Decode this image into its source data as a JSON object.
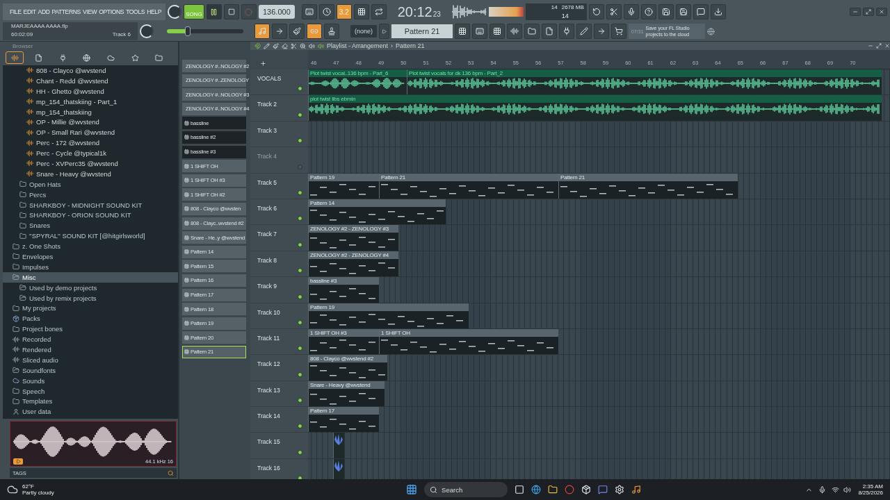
{
  "menu": [
    "FILE",
    "EDIT",
    "ADD",
    "PATTERNS",
    "VIEW",
    "OPTIONS",
    "TOOLS",
    "HELP"
  ],
  "project": {
    "file": "MARJEAAAA AAAA.flp",
    "time": "60:02:09",
    "track": "Track 6"
  },
  "transport": {
    "mode": "SONG",
    "playing": true,
    "recording": false,
    "tempo": "136.000",
    "time": "20:12",
    "ticks": "23"
  },
  "master_volume": {
    "level": 0.27
  },
  "toggles": [
    {
      "kind": "typing",
      "on": false
    },
    {
      "kind": "wait",
      "on": false
    },
    {
      "kind": "countdown",
      "label": "3.2",
      "on": true
    },
    {
      "kind": "step",
      "on": false
    },
    {
      "kind": "loop",
      "on": false
    }
  ],
  "memory": {
    "cpu": "14",
    "ram": "2678 MB",
    "polyphony": "14"
  },
  "edit_tools": [
    {
      "kind": "grid",
      "on": true
    },
    {
      "kind": "arrow",
      "on": false
    },
    {
      "kind": "brush",
      "on": false
    },
    {
      "kind": "link",
      "on": true
    },
    {
      "kind": "stamp",
      "on": false
    }
  ],
  "snap": "(none)",
  "pattern": "Pattern 21",
  "hint": {
    "counter": "07/31",
    "text": "Save your FL Studio projects to the cloud"
  },
  "browser": {
    "title": "Browser",
    "tree": [
      {
        "children": [
          {
            "children": [
              {
                "label": "808 - Clayco @wvstend",
                "kind": "file",
                "selected": false
              },
              {
                "label": "Chant - Redd @wvstend",
                "kind": "file",
                "selected": false
              },
              {
                "label": "HH - Ghetto @wvstend",
                "kind": "file",
                "selected": false
              },
              {
                "label": "mp_154_thatskiing - Part_1",
                "kind": "file",
                "selected": false
              },
              {
                "label": "mp_154_thatskiing",
                "kind": "file",
                "selected": false
              },
              {
                "label": "OP - Millie @wvstend",
                "kind": "file",
                "selected": false
              },
              {
                "label": "OP - Small Rari @wvstend",
                "kind": "file",
                "selected": false
              },
              {
                "label": "Perc - 172 @wvstend",
                "kind": "file",
                "selected": false
              },
              {
                "label": "Perc - Cycle @typical1k",
                "kind": "file",
                "selected": false
              },
              {
                "label": "Perc - XVPerc35 @wvstend",
                "kind": "file",
                "selected": false
              },
              {
                "label": "Snare - Heavy @wvstend",
                "kind": "file",
                "selected": false
              }
            ]
          },
          {
            "label": "Open Hats",
            "kind": "folder",
            "selected": false
          },
          {
            "label": "Percs",
            "kind": "folder",
            "selected": false
          },
          {
            "label": "SHARKBOY - MIDNIGHT SOUND KIT",
            "kind": "folder",
            "selected": false
          },
          {
            "label": "SHARKBOY - ORION SOUND KIT",
            "kind": "folder",
            "selected": false
          },
          {
            "label": "Snares",
            "kind": "folder",
            "selected": false
          },
          {
            "label": "''SPYRAL'' SOUND KIT [@hitgirlsworld]",
            "kind": "folder",
            "selected": false
          }
        ]
      },
      {
        "label": "z. One Shots",
        "kind": "folder",
        "selected": false
      },
      {
        "label": "Envelopes",
        "kind": "folder",
        "selected": false
      },
      {
        "label": "Impulses",
        "kind": "folder",
        "selected": false
      },
      {
        "label": "Misc",
        "kind": "folder-open",
        "selected": true,
        "children": [
          {
            "label": "Used by demo projects",
            "kind": "folder-open",
            "selected": false
          },
          {
            "label": "Used by remix projects",
            "kind": "folder-open",
            "selected": false
          }
        ]
      },
      {
        "label": "My projects",
        "kind": "folder",
        "selected": false
      },
      {
        "label": "Packs",
        "kind": "pack",
        "selected": false
      },
      {
        "label": "Project bones",
        "kind": "folder",
        "selected": false
      },
      {
        "label": "Recorded",
        "kind": "audio",
        "selected": false
      },
      {
        "label": "Rendered",
        "kind": "rendered",
        "selected": false
      },
      {
        "label": "Sliced audio",
        "kind": "audio",
        "selected": false
      },
      {
        "label": "Soundfonts",
        "kind": "folder-open",
        "selected": false
      },
      {
        "label": "Sounds",
        "kind": "cloud",
        "selected": false
      },
      {
        "label": "Speech",
        "kind": "folder",
        "selected": false
      },
      {
        "label": "Templates",
        "kind": "folder",
        "selected": false
      },
      {
        "label": "User data",
        "kind": "user",
        "selected": false
      }
    ],
    "preview_info": "44.1 kHz 16",
    "tags": "TAGS"
  },
  "patterns": [
    {
      "label": "ZENOLOGY #..NOLOGY #2",
      "color": "#556067",
      "selected": false
    },
    {
      "label": "ZENOLOGY #..ZENOLOGY",
      "color": "#556067",
      "selected": false
    },
    {
      "label": "ZENOLOGY #..NOLOGY #3",
      "color": "#556067",
      "selected": false
    },
    {
      "label": "ZENOLOGY #..NOLOGY #4",
      "color": "#556067",
      "selected": false
    },
    {
      "label": "bassline",
      "color": "#1d2326",
      "selected": false
    },
    {
      "label": "bassline #2",
      "color": "#1d2326",
      "selected": false
    },
    {
      "label": "bassline #3",
      "color": "#1d2326",
      "selected": false
    },
    {
      "label": "1 SHIFT OH",
      "color": "#556067",
      "selected": false
    },
    {
      "label": "1 SHIFT OH #3",
      "color": "#556067",
      "selected": false
    },
    {
      "label": "1 SHIFT OH #2",
      "color": "#556067",
      "selected": false
    },
    {
      "label": "808 - Clayco @wvsten",
      "color": "#556067",
      "selected": false
    },
    {
      "label": "808 - Clayc..wvstend #2",
      "color": "#556067",
      "selected": false
    },
    {
      "label": "Snare - He..y @wvstend",
      "color": "#556067",
      "selected": false
    },
    {
      "label": "Pattern 14",
      "color": "#556067",
      "selected": false
    },
    {
      "label": "Pattern 15",
      "color": "#556067",
      "selected": false
    },
    {
      "label": "Pattern 16",
      "color": "#556067",
      "selected": false
    },
    {
      "label": "Pattern 17",
      "color": "#556067",
      "selected": false
    },
    {
      "label": "Pattern 18",
      "color": "#556067",
      "selected": false
    },
    {
      "label": "Pattern 19",
      "color": "#556067",
      "selected": false
    },
    {
      "label": "Pattern 20",
      "color": "#556067",
      "selected": false
    },
    {
      "label": "Pattern 21",
      "color": "#556067",
      "selected": true
    }
  ],
  "playlist": {
    "title": "Playlist - Arrangement",
    "separator": "›",
    "pattern": "Pattern 21",
    "bars": [
      "46",
      "47",
      "48",
      "49",
      "50",
      "51",
      "52",
      "53",
      "54",
      "55",
      "56",
      "57",
      "58",
      "59",
      "60",
      "61",
      "62",
      "63",
      "64",
      "65",
      "66",
      "67",
      "68",
      "69",
      "70"
    ],
    "tracks": [
      {
        "name": "VOCALS",
        "muted": false,
        "clips": [
          {
            "label": "Plot twist vocal..136 bpm - Part_6",
            "kind": "audio"
          },
          {
            "label": "Plot twist vocals for dk 136 bpm - Part_2",
            "kind": "audio"
          }
        ]
      },
      {
        "name": "Track 2",
        "muted": false,
        "clips": [
          {
            "label": "plot twist libs ebmin",
            "kind": "audio"
          }
        ]
      },
      {
        "name": "Track 3",
        "muted": false
      },
      {
        "name": "Track 4",
        "muted": true
      },
      {
        "name": "Track 5",
        "muted": false,
        "clips": [
          {
            "label": "Pattern 19",
            "kind": "pattern"
          },
          {
            "label": "Pattern 21",
            "kind": "pattern"
          },
          {
            "label": "Pattern 21",
            "kind": "pattern"
          }
        ]
      },
      {
        "name": "Track 6",
        "muted": false,
        "clips": [
          {
            "label": "Pattern 14",
            "kind": "pattern"
          }
        ]
      },
      {
        "name": "Track 7",
        "muted": false,
        "clips": [
          {
            "label": "ZENOLOGY #2 - ZENOLOGY #3",
            "kind": "pattern"
          }
        ]
      },
      {
        "name": "Track 8",
        "muted": false,
        "clips": [
          {
            "label": "ZENOLOGY #2 - ZENOLOGY #4",
            "kind": "pattern"
          }
        ]
      },
      {
        "name": "Track 9",
        "muted": false,
        "clips": [
          {
            "label": "bassline #3",
            "kind": "pattern"
          }
        ]
      },
      {
        "name": "Track 10",
        "muted": false,
        "clips": [
          {
            "label": "Pattern 19",
            "kind": "pattern"
          }
        ]
      },
      {
        "name": "Track 11",
        "muted": false,
        "clips": [
          {
            "label": "1 SHIFT OH #3",
            "kind": "pattern"
          },
          {
            "label": "1 SHIFT OH",
            "kind": "pattern"
          }
        ]
      },
      {
        "name": "Track 12",
        "muted": false,
        "clips": [
          {
            "label": "808 - Clayco @wvstend #2",
            "kind": "pattern"
          }
        ]
      },
      {
        "name": "Track 13",
        "muted": false,
        "clips": [
          {
            "label": "Snare - Heavy @wvstend",
            "kind": "pattern"
          }
        ]
      },
      {
        "name": "Track 14",
        "muted": false,
        "clips": [
          {
            "label": "Pattern 17",
            "kind": "pattern"
          }
        ]
      },
      {
        "name": "Track 15",
        "muted": false,
        "clips": [
          {
            "kind": "sample"
          }
        ]
      },
      {
        "name": "Track 16",
        "muted": false,
        "clips": [
          {
            "kind": "sample"
          }
        ]
      }
    ]
  },
  "taskbar": {
    "temperature": "62°F",
    "weather": "Partly cloudy",
    "search": "Search",
    "time": "2:35 AM",
    "date": "8/25/2026"
  }
}
